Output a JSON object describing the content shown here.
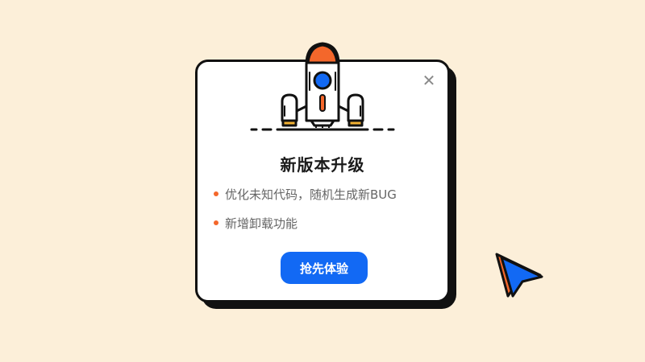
{
  "dialog": {
    "title": "新版本升级",
    "close_icon": "close-icon",
    "hero_icon": "rocket-icon",
    "features": [
      "优化未知代码，随机生成新BUG",
      "新增卸载功能"
    ],
    "cta_label": "抢先体验"
  },
  "decoration": {
    "pointer_icon": "cursor-arrow-icon"
  },
  "colors": {
    "background": "#fcefd9",
    "accent_blue": "#1269f4",
    "accent_orange": "#f4672b",
    "border": "#111111"
  }
}
